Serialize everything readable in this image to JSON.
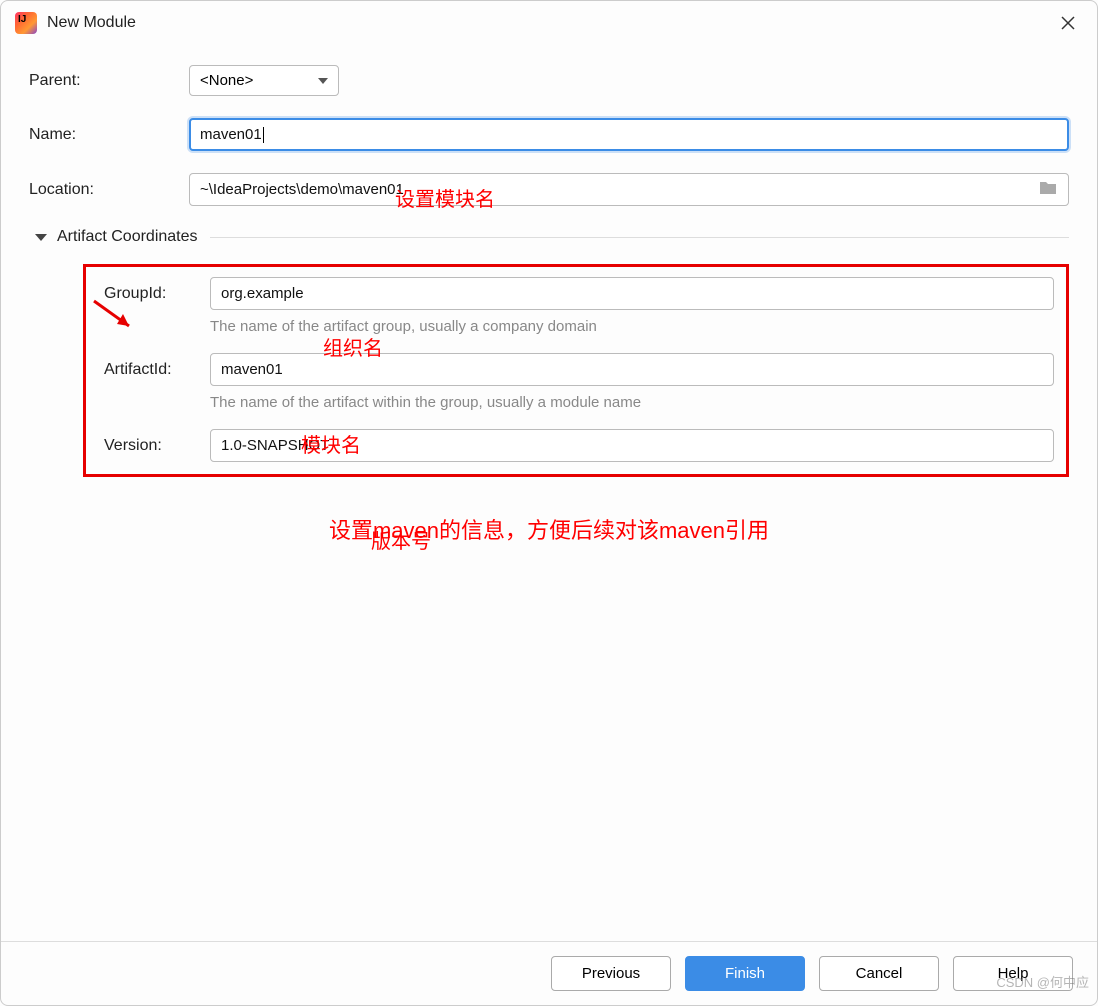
{
  "window": {
    "title": "New Module"
  },
  "form": {
    "parent": {
      "label": "Parent:",
      "value": "<None>"
    },
    "name": {
      "label": "Name:",
      "value": "maven01"
    },
    "location": {
      "label": "Location:",
      "value": "~\\IdeaProjects\\demo\\maven01"
    }
  },
  "section": {
    "title": "Artifact Coordinates"
  },
  "artifact": {
    "groupId": {
      "label": "GroupId:",
      "value": "org.example",
      "helper": "The name of the artifact group, usually a company domain"
    },
    "artifactId": {
      "label": "ArtifactId:",
      "value": "maven01",
      "helper": "The name of the artifact within the group, usually a module name"
    },
    "version": {
      "label": "Version:",
      "value": "1.0-SNAPSHOT"
    }
  },
  "annotations": {
    "name": "设置模块名",
    "group": "组织名",
    "artifact": "模块名",
    "version": "版本号",
    "bottom": "设置maven的信息，方便后续对该maven引用"
  },
  "footer": {
    "previous": "Previous",
    "finish": "Finish",
    "cancel": "Cancel",
    "help": "Help"
  },
  "watermark": "CSDN @何中应"
}
